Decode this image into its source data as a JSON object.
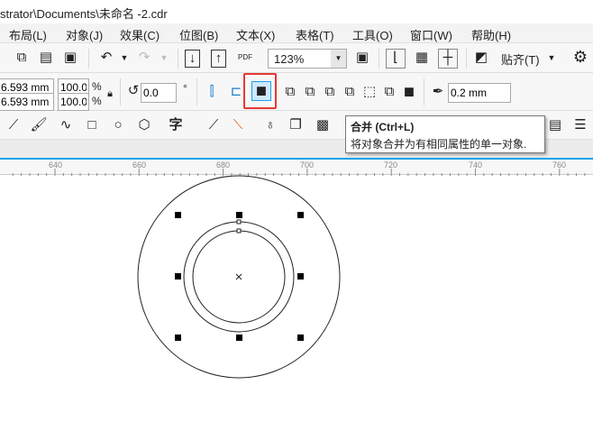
{
  "title": "strator\\Documents\\未命名 -2.cdr",
  "menu": [
    "布局(L)",
    "对象(J)",
    "效果(C)",
    "位图(B)",
    "文本(X)",
    "表格(T)",
    "工具(O)",
    "窗口(W)",
    "帮助(H)"
  ],
  "toolbar": {
    "zoom": "123%",
    "snap_label": "贴齐(T)",
    "pdf": "PDF"
  },
  "props": {
    "width": "6.593 mm",
    "height": "6.593 mm",
    "scale_x": "100.0",
    "scale_y": "100.0",
    "pct": "%",
    "rotation": "0.0",
    "deg": "°",
    "outline": "0.2 mm"
  },
  "toolbox": {
    "text_tool": "字"
  },
  "tooltip": {
    "title": "合并 (Ctrl+L)",
    "desc": "将对象合并为有相同属性的单一对象."
  },
  "ruler": [
    "640",
    "660",
    "680",
    "700",
    "720",
    "740",
    "760"
  ],
  "colors": {
    "accent": "#1aa3e8",
    "highlight": "#e53935"
  }
}
